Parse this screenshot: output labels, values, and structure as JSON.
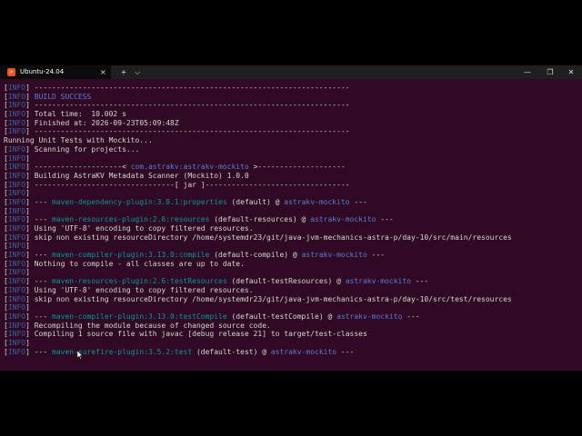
{
  "tab": {
    "title": "Ubuntu-24.04",
    "close": "×",
    "new_tab": "+",
    "dropdown": "⌵"
  },
  "window_controls": {
    "minimize": "—",
    "maximize": "❐",
    "close": "✕"
  },
  "tag": "INFO",
  "lines": [
    {
      "info": true,
      "pre": " ------------------------------------------------------------------------",
      "plugin": "",
      "mid": "",
      "artifact": "",
      "post": ""
    },
    {
      "info": true,
      "pre": " ",
      "plugin": "",
      "mid": "",
      "artifact": "BUILD SUCCESS",
      "post": ""
    },
    {
      "info": true,
      "pre": " ------------------------------------------------------------------------",
      "plugin": "",
      "mid": "",
      "artifact": "",
      "post": ""
    },
    {
      "info": true,
      "pre": " Total time:  10.002 s",
      "plugin": "",
      "mid": "",
      "artifact": "",
      "post": ""
    },
    {
      "info": true,
      "pre": " Finished at: 2026-09-23T05:09:48Z",
      "plugin": "",
      "mid": "",
      "artifact": "",
      "post": ""
    },
    {
      "info": true,
      "pre": " ------------------------------------------------------------------------",
      "plugin": "",
      "mid": "",
      "artifact": "",
      "post": ""
    },
    {
      "info": false,
      "pre": "Running Unit Tests with Mockito...",
      "plugin": "",
      "mid": "",
      "artifact": "",
      "post": ""
    },
    {
      "info": true,
      "pre": " Scanning for projects...",
      "plugin": "",
      "mid": "",
      "artifact": "",
      "post": ""
    },
    {
      "info": true,
      "pre": "",
      "plugin": "",
      "mid": "",
      "artifact": "",
      "post": ""
    },
    {
      "info": true,
      "pre": " --------------------< ",
      "plugin": "",
      "mid": "",
      "artifact": "com.astrakv:astrakv-mockito",
      "post": " >--------------------"
    },
    {
      "info": true,
      "pre": " Building AstraKV Metadata Scanner (Mockito) 1.0.0",
      "plugin": "",
      "mid": "",
      "artifact": "",
      "post": ""
    },
    {
      "info": true,
      "pre": " --------------------------------[ jar ]---------------------------------",
      "plugin": "",
      "mid": "",
      "artifact": "",
      "post": ""
    },
    {
      "info": true,
      "pre": "",
      "plugin": "",
      "mid": "",
      "artifact": "",
      "post": ""
    },
    {
      "info": true,
      "pre": " --- ",
      "plugin": "maven-dependency-plugin:3.8.1:properties",
      "mid": " (default) @ ",
      "artifact": "astrakv-mockito",
      "post": " ---"
    },
    {
      "info": true,
      "pre": "",
      "plugin": "",
      "mid": "",
      "artifact": "",
      "post": ""
    },
    {
      "info": true,
      "pre": " --- ",
      "plugin": "maven-resources-plugin:2.6:resources",
      "mid": " (default-resources) @ ",
      "artifact": "astrakv-mockito",
      "post": " ---"
    },
    {
      "info": true,
      "pre": " Using 'UTF-8' encoding to copy filtered resources.",
      "plugin": "",
      "mid": "",
      "artifact": "",
      "post": ""
    },
    {
      "info": true,
      "pre": " skip non existing resourceDirectory /home/systemdr23/git/java-jvm-mechanics-astra-p/day-10/src/main/resources",
      "plugin": "",
      "mid": "",
      "artifact": "",
      "post": ""
    },
    {
      "info": true,
      "pre": "",
      "plugin": "",
      "mid": "",
      "artifact": "",
      "post": ""
    },
    {
      "info": true,
      "pre": " --- ",
      "plugin": "maven-compiler-plugin:3.13.0:compile",
      "mid": " (default-compile) @ ",
      "artifact": "astrakv-mockito",
      "post": " ---"
    },
    {
      "info": true,
      "pre": " Nothing to compile - all classes are up to date.",
      "plugin": "",
      "mid": "",
      "artifact": "",
      "post": ""
    },
    {
      "info": true,
      "pre": "",
      "plugin": "",
      "mid": "",
      "artifact": "",
      "post": ""
    },
    {
      "info": true,
      "pre": " --- ",
      "plugin": "maven-resources-plugin:2.6:testResources",
      "mid": " (default-testResources) @ ",
      "artifact": "astrakv-mockito",
      "post": " ---"
    },
    {
      "info": true,
      "pre": " Using 'UTF-8' encoding to copy filtered resources.",
      "plugin": "",
      "mid": "",
      "artifact": "",
      "post": ""
    },
    {
      "info": true,
      "pre": " skip non existing resourceDirectory /home/systemdr23/git/java-jvm-mechanics-astra-p/day-10/src/test/resources",
      "plugin": "",
      "mid": "",
      "artifact": "",
      "post": ""
    },
    {
      "info": true,
      "pre": "",
      "plugin": "",
      "mid": "",
      "artifact": "",
      "post": ""
    },
    {
      "info": true,
      "pre": " --- ",
      "plugin": "maven-compiler-plugin:3.13.0:testCompile",
      "mid": " (default-testCompile) @ ",
      "artifact": "astrakv-mockito",
      "post": " ---"
    },
    {
      "info": true,
      "pre": " Recompiling the module because of changed source code.",
      "plugin": "",
      "mid": "",
      "artifact": "",
      "post": ""
    },
    {
      "info": true,
      "pre": " Compiling 1 source file with javac [debug release 21] to target/test-classes",
      "plugin": "",
      "mid": "",
      "artifact": "",
      "post": ""
    },
    {
      "info": true,
      "pre": "",
      "plugin": "",
      "mid": "",
      "artifact": "",
      "post": ""
    },
    {
      "info": true,
      "pre": " --- ",
      "plugin": "maven-surefire-plugin:3.5.2:test",
      "mid": " (default-test) @ ",
      "artifact": "astrakv-mockito",
      "post": " ---"
    }
  ],
  "colors": {
    "background": "#300a24",
    "info": "#3465a4",
    "plugin": "#06989a",
    "artifact": "#5c7bd0",
    "text": "#d3d7cf"
  }
}
